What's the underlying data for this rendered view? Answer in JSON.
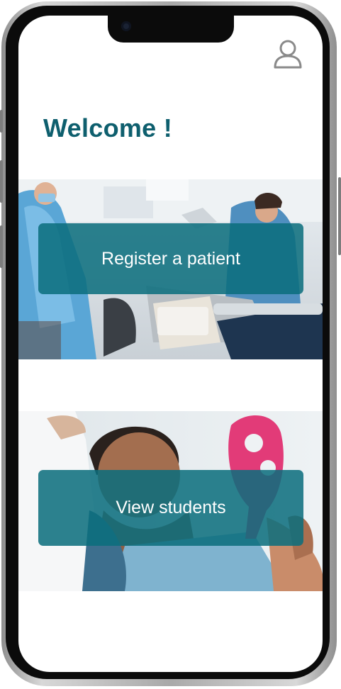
{
  "welcome": {
    "title": "Welcome !"
  },
  "actions": [
    {
      "label": "Register a patient",
      "image": "dental-clinic-team-photo"
    },
    {
      "label": "View students",
      "image": "patient-with-mirror-photo"
    }
  ],
  "icons": {
    "profile": "user-profile-icon"
  },
  "colors": {
    "accent": "#0e5f6e",
    "button_overlay": "#0a6e7d"
  }
}
